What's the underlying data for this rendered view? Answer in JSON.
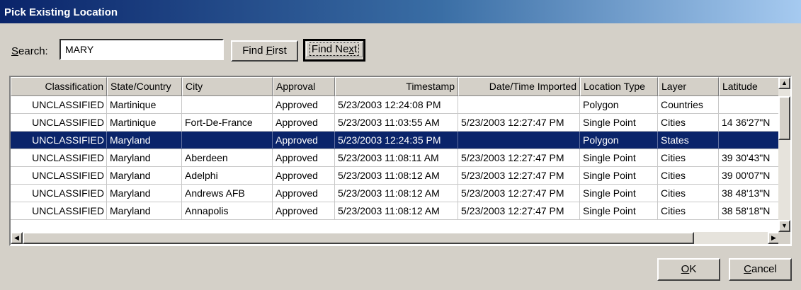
{
  "window": {
    "title": "Pick Existing Location"
  },
  "search": {
    "label_pre": "",
    "label_accel": "S",
    "label_post": "earch:",
    "value": "MARY"
  },
  "buttons": {
    "find_first_pre": "Find ",
    "find_first_accel": "F",
    "find_first_post": "irst",
    "find_next_pre": "Find Ne",
    "find_next_accel": "x",
    "find_next_post": "t",
    "ok_accel": "O",
    "ok_post": "K",
    "cancel_accel": "C",
    "cancel_post": "ancel"
  },
  "grid": {
    "columns": [
      "Classification",
      "State/Country",
      "City",
      "Approval",
      "Timestamp",
      "Date/Time Imported",
      "Location Type",
      "Layer",
      "Latitude"
    ],
    "rows": [
      [
        "UNCLASSIFIED",
        "Martinique",
        "",
        "Approved",
        "5/23/2003 12:24:08 PM",
        "",
        "Polygon",
        "Countries",
        ""
      ],
      [
        "UNCLASSIFIED",
        "Martinique",
        "Fort-De-France",
        "Approved",
        "5/23/2003 11:03:55 AM",
        "5/23/2003 12:27:47 PM",
        "Single Point",
        "Cities",
        "14 36'27\"N"
      ],
      [
        "UNCLASSIFIED",
        "Maryland",
        "",
        "Approved",
        "5/23/2003 12:24:35 PM",
        "",
        "Polygon",
        "States",
        ""
      ],
      [
        "UNCLASSIFIED",
        "Maryland",
        "Aberdeen",
        "Approved",
        "5/23/2003 11:08:11 AM",
        "5/23/2003 12:27:47 PM",
        "Single Point",
        "Cities",
        "39 30'43\"N"
      ],
      [
        "UNCLASSIFIED",
        "Maryland",
        "Adelphi",
        "Approved",
        "5/23/2003 11:08:12 AM",
        "5/23/2003 12:27:47 PM",
        "Single Point",
        "Cities",
        "39 00'07\"N"
      ],
      [
        "UNCLASSIFIED",
        "Maryland",
        "Andrews AFB",
        "Approved",
        "5/23/2003 11:08:12 AM",
        "5/23/2003 12:27:47 PM",
        "Single Point",
        "Cities",
        "38 48'13\"N"
      ],
      [
        "UNCLASSIFIED",
        "Maryland",
        "Annapolis",
        "Approved",
        "5/23/2003 11:08:12 AM",
        "5/23/2003 12:27:47 PM",
        "Single Point",
        "Cities",
        "38 58'18\"N"
      ]
    ],
    "selected_row": 2
  },
  "icons": {
    "up": "▲",
    "down": "▼",
    "left": "◀",
    "right": "▶"
  }
}
